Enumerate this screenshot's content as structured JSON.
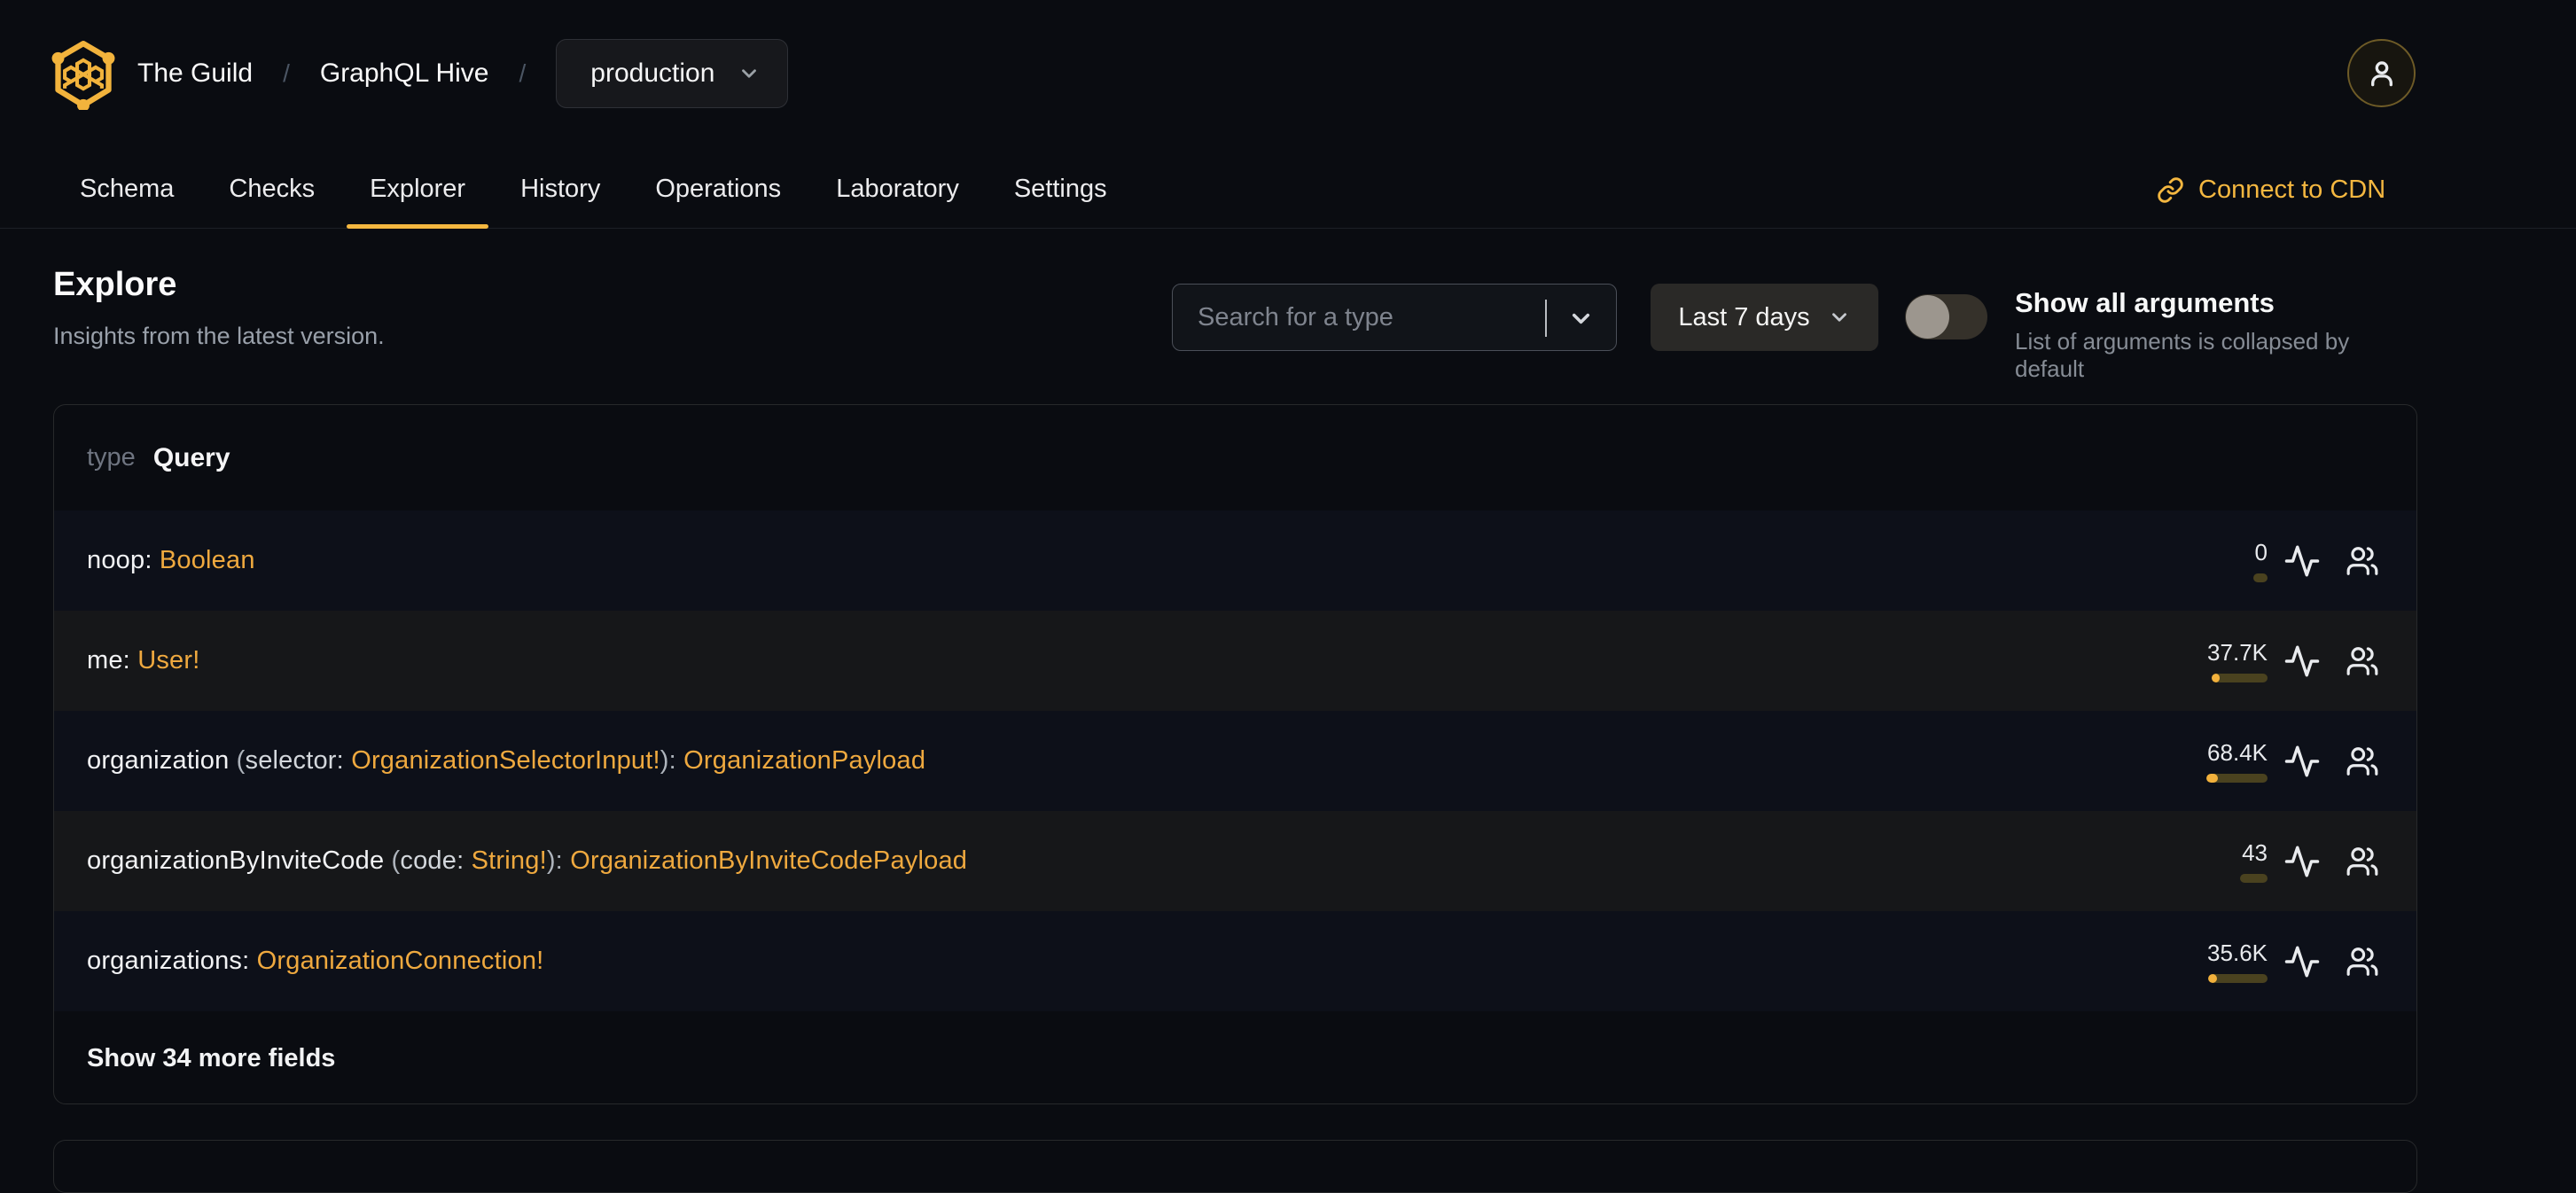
{
  "header": {
    "breadcrumb": {
      "org": "The Guild",
      "separator": "/",
      "project": "GraphQL Hive",
      "target": "production"
    },
    "nav": {
      "tabs": {
        "schema": "Schema",
        "checks": "Checks",
        "explorer": "Explorer",
        "history": "History",
        "operations": "Operations",
        "laboratory": "Laboratory",
        "settings": "Settings"
      },
      "active_tab": "Explorer",
      "connect_cdn_label": "Connect to CDN"
    }
  },
  "page": {
    "title": "Explore",
    "subtitle": "Insights from the latest version."
  },
  "controls": {
    "type_search_placeholder": "Search for a type",
    "period_label": "Last 7 days",
    "arguments_toggle": {
      "state": "off",
      "label": "Show all arguments",
      "description": "List of arguments is collapsed by default"
    }
  },
  "type_card": {
    "kind": "type",
    "name": "Query",
    "fields": [
      {
        "tokens": [
          {
            "style": "name",
            "text": "noop: "
          },
          {
            "style": "type",
            "text": "Boolean"
          }
        ],
        "requests": "0",
        "bar": {
          "width": 16,
          "fill": 0
        }
      },
      {
        "tokens": [
          {
            "style": "name",
            "text": "me: "
          },
          {
            "style": "type",
            "text": "User!"
          }
        ],
        "requests": "37.7K",
        "bar": {
          "width": 63,
          "fill": 9
        }
      },
      {
        "tokens": [
          {
            "style": "name",
            "text": "organization "
          },
          {
            "style": "punct",
            "text": "("
          },
          {
            "style": "arg",
            "text": "selector: "
          },
          {
            "style": "type",
            "text": "OrganizationSelectorInput!"
          },
          {
            "style": "punct",
            "text": "): "
          },
          {
            "style": "type",
            "text": "OrganizationPayload"
          }
        ],
        "requests": "68.4K",
        "bar": {
          "width": 69,
          "fill": 13
        }
      },
      {
        "tokens": [
          {
            "style": "name",
            "text": "organizationByInviteCode "
          },
          {
            "style": "punct",
            "text": "("
          },
          {
            "style": "arg",
            "text": "code: "
          },
          {
            "style": "type",
            "text": "String!"
          },
          {
            "style": "punct",
            "text": "): "
          },
          {
            "style": "type",
            "text": "OrganizationByInviteCodePayload"
          }
        ],
        "requests": "43",
        "bar": {
          "width": 31,
          "fill": 0
        }
      },
      {
        "tokens": [
          {
            "style": "name",
            "text": "organizations: "
          },
          {
            "style": "type",
            "text": "OrganizationConnection!"
          }
        ],
        "requests": "35.6K",
        "bar": {
          "width": 67,
          "fill": 10
        }
      }
    ],
    "show_more_label": "Show 34 more fields"
  },
  "colors": {
    "background": "#0a0c11",
    "accent": "#f4b740",
    "type_link": "#efa93f",
    "bar_track": "#4a421f",
    "bar_fill": "#f2b13c",
    "row_odd": "#161719",
    "row_even": "#0d1019"
  }
}
